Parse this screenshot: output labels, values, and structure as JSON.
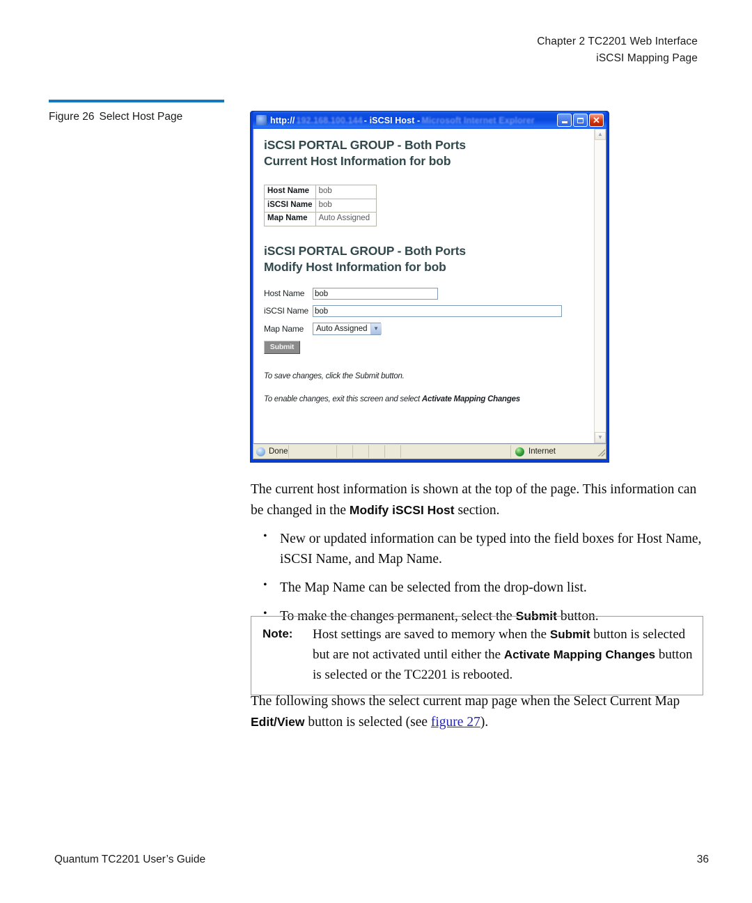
{
  "header": {
    "line1": "Chapter 2  TC2201 Web Interface",
    "line2": "iSCSI Mapping Page"
  },
  "figure": {
    "number": "Figure 26",
    "caption": "Select Host Page",
    "rule_color": "#1478be"
  },
  "browser": {
    "titlebar": {
      "protocol": "http://",
      "redacted_ip": "192.168.100.144",
      "page_title": " - iSCSI Host - ",
      "app_name": "Microsoft Internet Explorer",
      "minimize_label": "Minimize",
      "maximize_label": "Maximize",
      "close_label": "Close"
    },
    "page": {
      "current_section": {
        "heading_line1": "iSCSI PORTAL GROUP - Both Ports",
        "heading_line2": "Current Host Information for bob",
        "heading_color": "#31494c",
        "rows": [
          {
            "label": "Host Name",
            "value": "bob"
          },
          {
            "label": "iSCSI Name",
            "value": "bob"
          },
          {
            "label": "Map Name",
            "value": "Auto Assigned"
          }
        ]
      },
      "modify_section": {
        "heading_line1": "iSCSI PORTAL GROUP - Both Ports",
        "heading_line2": "Modify Host Information for bob",
        "fields": [
          {
            "label": "Host Name",
            "value": "bob",
            "type": "text"
          },
          {
            "label": "iSCSI Name",
            "value": "bob",
            "type": "text"
          },
          {
            "label": "Map Name",
            "value": "Auto Assigned",
            "type": "select"
          }
        ],
        "submit_label": "Submit"
      },
      "notes": {
        "save_note": "To save changes, click the Submit button.",
        "enable_note_prefix": "To enable changes, exit this screen and select ",
        "enable_note_bold": "Activate Mapping Changes"
      }
    },
    "statusbar": {
      "status": "Done",
      "zone": "Internet"
    }
  },
  "body": {
    "intro_part1": "The current host information is shown at the top of the page. This information can be changed in the ",
    "intro_bold": "Modify iSCSI Host",
    "intro_part2": " section.",
    "bullets": [
      "New or updated information can be typed into the field boxes for Host Name, iSCSI Name, and Map Name.",
      "The Map Name can be selected from the drop-down list."
    ],
    "bullet3_part1": "To make the changes permanent, select the ",
    "bullet3_bold": "Submit",
    "bullet3_part2": " button."
  },
  "note": {
    "label": "Note:",
    "part1": "Host settings are saved to memory when the ",
    "bold1": "Submit",
    "part2": " button is selected but are not activated until either the ",
    "bold2": "Activate Mapping Changes",
    "part3": " button is selected or the TC2201 is rebooted."
  },
  "closing": {
    "part1": "The following shows the select current map page when the Select Current Map ",
    "bold1": "Edit/View",
    "part2": " button is selected (see ",
    "link": "figure 27",
    "part3": ")."
  },
  "footer": {
    "guide": "Quantum TC2201 User’s Guide",
    "page_number": "36"
  }
}
